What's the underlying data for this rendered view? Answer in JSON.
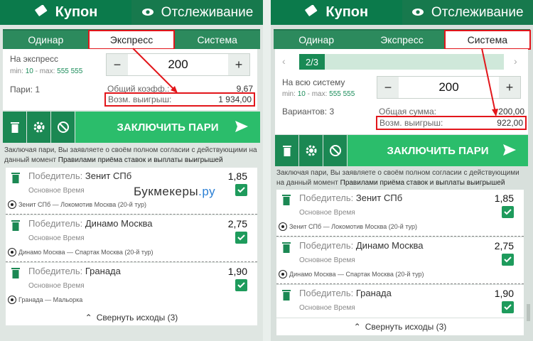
{
  "left": {
    "tabs_top": {
      "coupon": "Купон",
      "tracking": "Отслеживание"
    },
    "tabs": [
      "Одинар",
      "Экспресс",
      "Система"
    ],
    "stake_label": "На экспресс",
    "minmax": {
      "min_label": "min:",
      "min": "10",
      "max_label": "- max:",
      "max": "555 555"
    },
    "stake": "200",
    "bets_label": "Пари:",
    "bets_count": "1",
    "total_coef_label": "Общий коэфф.:",
    "total_coef": "9,67",
    "win_label": "Возм. выигрыш:",
    "win": "1 934,00",
    "place_bet": "ЗАКЛЮЧИТЬ ПАРИ",
    "terms": "Заключая пари, Вы заявляете о своём полном согласии с действующими на данный момент",
    "terms_link": "Правилами приёма ставок и выплаты выигрышей",
    "bets": [
      {
        "winner": "Победитель:",
        "team": "Зенит СПб",
        "odds": "1,85",
        "time": "Основное Время",
        "match": "Зенит СПб — Локомотив Москва (20-й тур)"
      },
      {
        "winner": "Победитель:",
        "team": "Динамо Москва",
        "odds": "2,75",
        "time": "Основное Время",
        "match": "Динамо Москва — Спартак Москва (20-й тур)"
      },
      {
        "winner": "Победитель:",
        "team": "Гранада",
        "odds": "1,90",
        "time": "Основное Время",
        "match": "Гранада — Мальорка"
      }
    ],
    "collapse": "Свернуть исходы (3)",
    "watermark": "Букмекеры",
    "watermark_ru": ".ру"
  },
  "right": {
    "tabs_top": {
      "coupon": "Купон",
      "tracking": "Отслеживание"
    },
    "tabs": [
      "Одинар",
      "Экспресс",
      "Система"
    ],
    "pager": "2/3",
    "stake_label": "На всю систему",
    "minmax": {
      "min_label": "min:",
      "min": "10",
      "max_label": "- max:",
      "max": "555 555"
    },
    "stake": "200",
    "variants_label": "Вариантов:",
    "variants": "3",
    "total_sum_label": "Общая сумма:",
    "total_sum": "200,00",
    "win_label": "Возм. выигрыш:",
    "win": "922,00",
    "place_bet": "ЗАКЛЮЧИТЬ ПАРИ",
    "terms": "Заключая пари, Вы заявляете о своём полном согласии с действующими на данный момент",
    "terms_link": "Правилами приёма ставок и выплаты выигрышей",
    "bets": [
      {
        "winner": "Победитель:",
        "team": "Зенит СПб",
        "odds": "1,85",
        "time": "Основное Время",
        "match": "Зенит СПб — Локомотив Москва (20-й тур)"
      },
      {
        "winner": "Победитель:",
        "team": "Динамо Москва",
        "odds": "2,75",
        "time": "Основное Время",
        "match": "Динамо Москва — Спартак Москва (20-й тур)"
      },
      {
        "winner": "Победитель:",
        "team": "Гранада",
        "odds": "1,90",
        "time": "Основное Время"
      }
    ],
    "collapse": "Свернуть исходы (3)"
  },
  "colors": {
    "header": "#0b7a4b",
    "tab_bar": "#2c8a5d",
    "action": "#2bbd6b",
    "highlight": "#e2161b"
  },
  "icons": [
    "ticket-icon",
    "eye-icon",
    "minus-icon",
    "plus-icon",
    "trash-icon",
    "gear-icon",
    "no-entry-icon",
    "send-arrow-icon",
    "check-icon",
    "soccer-ball-icon",
    "chevron-up-icon",
    "chevron-left-icon",
    "chevron-right-icon"
  ]
}
